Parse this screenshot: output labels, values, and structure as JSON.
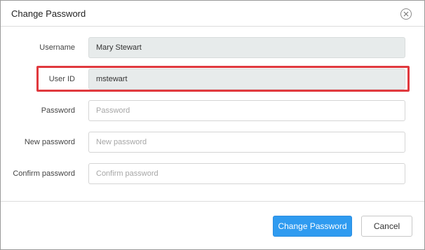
{
  "dialog": {
    "title": "Change Password",
    "close_icon": "close-icon"
  },
  "form": {
    "username": {
      "label": "Username",
      "value": "Mary Stewart"
    },
    "user_id": {
      "label": "User ID",
      "value": "mstewart"
    },
    "password": {
      "label": "Password",
      "placeholder": "Password",
      "value": ""
    },
    "new_password": {
      "label": "New password",
      "placeholder": "New password",
      "value": ""
    },
    "confirm_password": {
      "label": "Confirm password",
      "placeholder": "Confirm password",
      "value": ""
    }
  },
  "buttons": {
    "primary_label": "Change Password",
    "cancel_label": "Cancel"
  },
  "colors": {
    "primary": "#2f9bf0",
    "highlight": "#e0393e",
    "readonly_field": "#e7ebeb"
  }
}
